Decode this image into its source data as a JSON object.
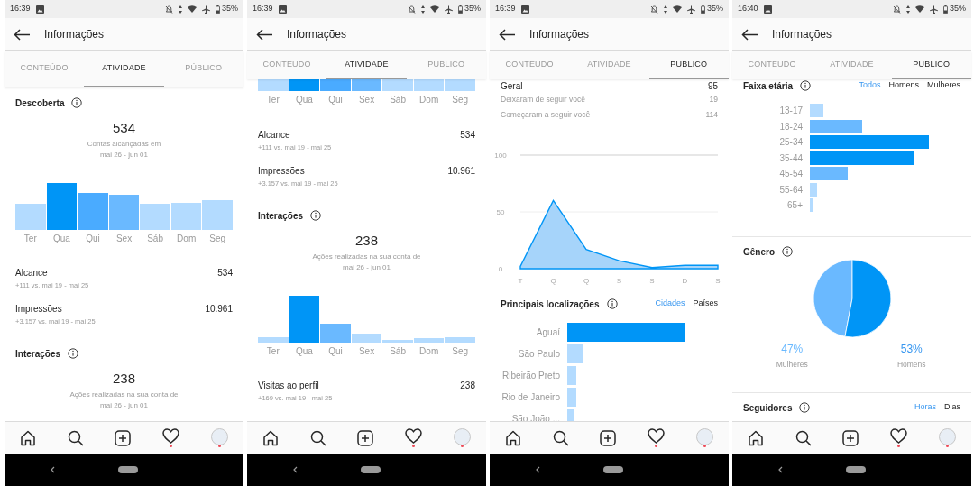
{
  "phones": [
    {
      "time": "16:39",
      "battery": "35%",
      "title": "Informações",
      "tabs": [
        {
          "label": "CONTEÚDO",
          "selected": false
        },
        {
          "label": "ATIVIDADE",
          "selected": true
        },
        {
          "label": "PÚBLICO",
          "selected": false
        }
      ],
      "sections": [
        {
          "kind": "heading",
          "title": "Descoberta"
        },
        {
          "kind": "summary",
          "value": "534",
          "caption": "Contas alcançadas em\nmai 26 - jun 01"
        },
        {
          "kind": "reach_chart",
          "labels": [
            "Ter",
            "Qua",
            "Qui",
            "Sex",
            "Sáb",
            "Dom",
            "Seg"
          ]
        },
        {
          "kind": "metric",
          "label": "Alcance",
          "value": "534",
          "change": "+111 vs. mai 19 - mai 25"
        },
        {
          "kind": "metric",
          "label": "Impressões",
          "value": "10.961",
          "change": "+3.157 vs. mai 19 - mai 25"
        },
        {
          "kind": "heading",
          "title": "Interações"
        },
        {
          "kind": "summary",
          "value": "238",
          "caption": "Ações realizadas na sua conta de\nmai 26 - jun 01"
        }
      ]
    },
    {
      "time": "16:39",
      "battery": "35%",
      "title": "Informações",
      "tabs": [
        {
          "label": "CONTEÚDO",
          "selected": false
        },
        {
          "label": "ATIVIDADE",
          "selected": true
        },
        {
          "label": "PÚBLICO",
          "selected": false
        }
      ],
      "sections": [
        {
          "kind": "reach_chart_tail",
          "labels": [
            "Ter",
            "Qua",
            "Qui",
            "Sex",
            "Sáb",
            "Dom",
            "Seg"
          ]
        },
        {
          "kind": "metric",
          "label": "Alcance",
          "value": "534",
          "change": "+111 vs. mai 19 - mai 25"
        },
        {
          "kind": "metric",
          "label": "Impressões",
          "value": "10.961",
          "change": "+3.157 vs. mai 19 - mai 25"
        },
        {
          "kind": "heading",
          "title": "Interações"
        },
        {
          "kind": "summary",
          "value": "238",
          "caption": "Ações realizadas na sua conta de\nmai 26 - jun 01"
        },
        {
          "kind": "interactions_chart",
          "labels": [
            "Ter",
            "Qua",
            "Qui",
            "Sex",
            "Sáb",
            "Dom",
            "Seg"
          ]
        },
        {
          "kind": "metric",
          "label": "Visitas ao perfil",
          "value": "238",
          "change": "+169 vs. mai 19 - mai 25"
        }
      ]
    },
    {
      "time": "16:39",
      "battery": "35%",
      "title": "Informações",
      "tabs": [
        {
          "label": "CONTEÚDO",
          "selected": false
        },
        {
          "label": "ATIVIDADE",
          "selected": false
        },
        {
          "label": "PÚBLICO",
          "selected": true
        }
      ],
      "sections": [
        {
          "kind": "stat_total",
          "label": "Geral",
          "value": "95"
        },
        {
          "kind": "stat",
          "label": "Deixaram de seguir você",
          "value": "19"
        },
        {
          "kind": "stat",
          "label": "Começaram a seguir você",
          "value": "114"
        },
        {
          "kind": "area_chart",
          "chart_data": {
            "type": "area",
            "x": [
              "T",
              "Q",
              "Q",
              "S",
              "S",
              "D",
              "S"
            ],
            "series": [
              {
                "color": "#0095f6",
                "values": [
                  2,
                  60,
                  17,
                  7,
                  1,
                  3,
                  3
                ]
              }
            ],
            "ylim": [
              0,
              100
            ],
            "yticks": [
              0,
              50,
              100
            ]
          }
        },
        {
          "kind": "heading",
          "title": "Principais localizações",
          "filters": [
            {
              "label": "Cidades",
              "selected": true
            },
            {
              "label": "Países",
              "selected": false
            }
          ]
        },
        {
          "kind": "location_chart",
          "labels": [
            "Aguaí",
            "São Paulo",
            "Ribeirão Preto",
            "Rio de Janeiro",
            "São João ..."
          ]
        }
      ]
    },
    {
      "time": "16:40",
      "battery": "35%",
      "title": "Informações",
      "tabs": [
        {
          "label": "CONTEÚDO",
          "selected": false
        },
        {
          "label": "ATIVIDADE",
          "selected": false
        },
        {
          "label": "PÚBLICO",
          "selected": true
        }
      ],
      "sections": [
        {
          "kind": "heading",
          "title": "Faixa etária",
          "filters": [
            {
              "label": "Todos",
              "selected": true
            },
            {
              "label": "Homens",
              "selected": false
            },
            {
              "label": "Mulheres",
              "selected": false
            }
          ]
        },
        {
          "kind": "age_chart",
          "labels": [
            "13-17",
            "18-24",
            "25-34",
            "35-44",
            "45-54",
            "55-64",
            "65+"
          ]
        },
        {
          "kind": "heading",
          "title": "Gênero"
        },
        {
          "kind": "pie_chart",
          "chart_data": {
            "type": "pie",
            "categories": [
              "Mulheres",
              "Homens"
            ],
            "values": [
              47,
              53
            ],
            "value_labels": [
              "47%",
              "53%"
            ]
          }
        },
        {
          "kind": "heading",
          "title": "Seguidores",
          "filters": [
            {
              "label": "Horas",
              "selected": true
            },
            {
              "label": "Dias",
              "selected": false
            }
          ]
        }
      ]
    }
  ]
}
